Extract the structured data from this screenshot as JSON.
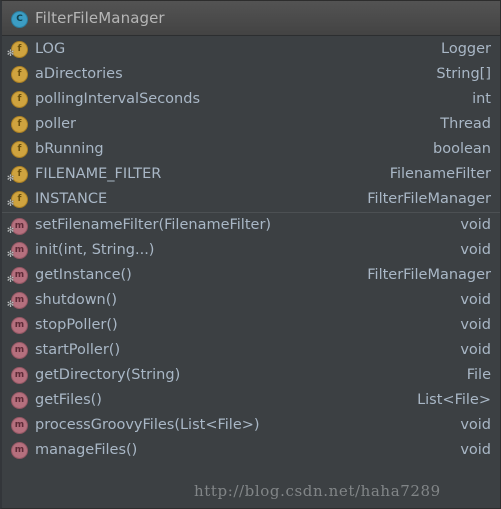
{
  "header": {
    "icon": "class-icon",
    "title": "FilterFileManager"
  },
  "members": [
    {
      "icon": "field-icon",
      "static": true,
      "name": "LOG",
      "type": "Logger",
      "section": "fields"
    },
    {
      "icon": "field-icon",
      "static": false,
      "name": "aDirectories",
      "type": "String[]",
      "section": "fields"
    },
    {
      "icon": "field-icon",
      "static": false,
      "name": "pollingIntervalSeconds",
      "type": "int",
      "section": "fields"
    },
    {
      "icon": "field-icon",
      "static": false,
      "name": "poller",
      "type": "Thread",
      "section": "fields"
    },
    {
      "icon": "field-icon",
      "static": false,
      "name": "bRunning",
      "type": "boolean",
      "section": "fields"
    },
    {
      "icon": "field-icon",
      "static": true,
      "name": "FILENAME_FILTER",
      "type": "FilenameFilter",
      "section": "fields"
    },
    {
      "icon": "field-icon",
      "static": true,
      "name": "INSTANCE",
      "type": "FilterFileManager",
      "section": "fields"
    },
    {
      "icon": "method-icon",
      "static": true,
      "name": "setFilenameFilter(FilenameFilter)",
      "type": "void",
      "section": "methods"
    },
    {
      "icon": "method-icon",
      "static": true,
      "name": "init(int, String...)",
      "type": "void",
      "section": "methods"
    },
    {
      "icon": "method-icon",
      "static": true,
      "name": "getInstance()",
      "type": "FilterFileManager",
      "section": "methods"
    },
    {
      "icon": "method-icon",
      "static": true,
      "name": "shutdown()",
      "type": "void",
      "section": "methods"
    },
    {
      "icon": "method-icon",
      "static": false,
      "name": "stopPoller()",
      "type": "void",
      "section": "methods"
    },
    {
      "icon": "method-icon",
      "static": false,
      "name": "startPoller()",
      "type": "void",
      "section": "methods"
    },
    {
      "icon": "method-icon",
      "static": false,
      "name": "getDirectory(String)",
      "type": "File",
      "section": "methods"
    },
    {
      "icon": "method-icon",
      "static": false,
      "name": "getFiles()",
      "type": "List<File>",
      "section": "methods"
    },
    {
      "icon": "method-icon",
      "static": false,
      "name": "processGroovyFiles(List<File>)",
      "type": "void",
      "section": "methods"
    },
    {
      "icon": "method-icon",
      "static": false,
      "name": "manageFiles()",
      "type": "void",
      "section": "methods"
    }
  ],
  "watermark": {
    "text": "http://blog.csdn.net/haha7289"
  },
  "glyphs": {
    "class": "C",
    "field": "f",
    "method": "m"
  },
  "colors": {
    "background": "#3c4043",
    "header_background": "#4c4c4c",
    "text": "#a9b7c6",
    "title_text": "#b6b6b6",
    "class_icon": "#3c9dc4",
    "field_icon": "#cfa33f",
    "method_icon": "#b5707e",
    "separator": "#4c5053"
  }
}
